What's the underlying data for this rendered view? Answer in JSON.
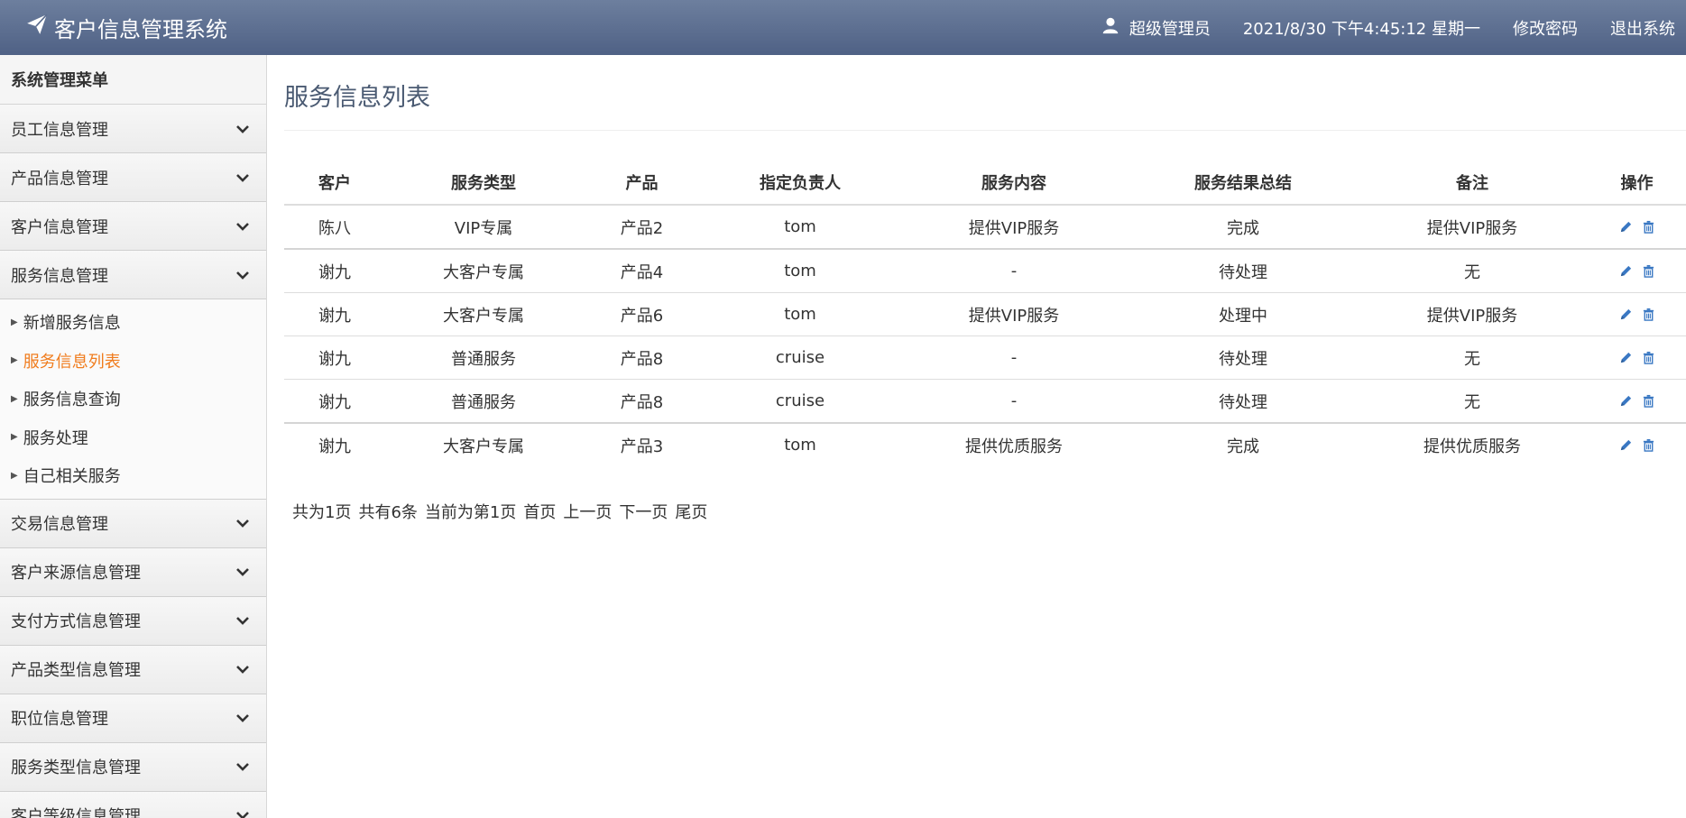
{
  "app": {
    "title": "客户信息管理系统",
    "user": "超级管理员",
    "datetime": "2021/8/30 下午4:45:12 星期一",
    "change_password": "修改密码",
    "logout": "退出系统"
  },
  "sidebar": {
    "header": "系统管理菜单",
    "groups_before": [
      {
        "label": "员工信息管理"
      },
      {
        "label": "产品信息管理"
      },
      {
        "label": "客户信息管理"
      },
      {
        "label": "服务信息管理"
      }
    ],
    "sub_items": [
      {
        "label": "新增服务信息"
      },
      {
        "label": "服务信息列表"
      },
      {
        "label": "服务信息查询"
      },
      {
        "label": "服务处理"
      },
      {
        "label": "自己相关服务"
      }
    ],
    "groups_after": [
      {
        "label": "交易信息管理"
      },
      {
        "label": "客户来源信息管理"
      },
      {
        "label": "支付方式信息管理"
      },
      {
        "label": "产品类型信息管理"
      },
      {
        "label": "职位信息管理"
      },
      {
        "label": "服务类型信息管理"
      },
      {
        "label": "客户等级信息管理"
      }
    ]
  },
  "main": {
    "title": "服务信息列表",
    "columns": [
      "客户",
      "服务类型",
      "产品",
      "指定负责人",
      "服务内容",
      "服务结果总结",
      "备注",
      "操作"
    ],
    "rows": [
      [
        "陈八",
        "VIP专属",
        "产品2",
        "tom",
        "提供VIP服务",
        "完成",
        "提供VIP服务"
      ],
      [
        "谢九",
        "大客户专属",
        "产品4",
        "tom",
        "-",
        "待处理",
        "无"
      ],
      [
        "谢九",
        "大客户专属",
        "产品6",
        "tom",
        "提供VIP服务",
        "处理中",
        "提供VIP服务"
      ],
      [
        "谢九",
        "普通服务",
        "产品8",
        "cruise",
        "-",
        "待处理",
        "无"
      ],
      [
        "谢九",
        "普通服务",
        "产品8",
        "cruise",
        "-",
        "待处理",
        "无"
      ],
      [
        "谢九",
        "大客户专属",
        "产品3",
        "tom",
        "提供优质服务",
        "完成",
        "提供优质服务"
      ]
    ],
    "pager": {
      "total_pages": "共为1页",
      "total_items": "共有6条",
      "current": "当前为第1页",
      "first": "首页",
      "prev": "上一页",
      "next": "下一页",
      "last": "尾页"
    }
  },
  "colors": {
    "topbar": "#5a6c8e",
    "active_menu": "#f07c1d",
    "icon_blue": "#3a78c3"
  },
  "icons": {
    "brand": "paper-plane-icon",
    "user": "user-icon",
    "chevron": "chevron-down-icon",
    "edit": "pencil-icon",
    "delete": "trash-icon"
  }
}
